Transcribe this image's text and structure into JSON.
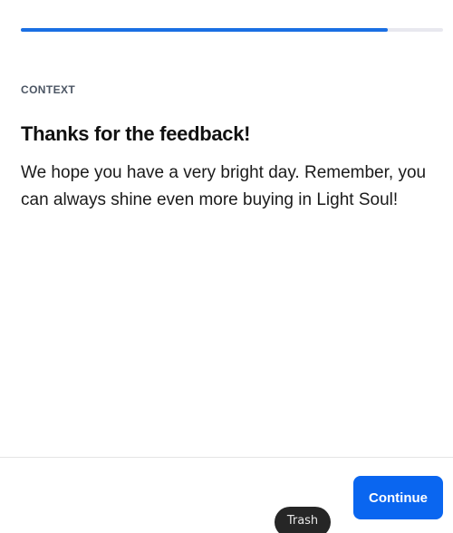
{
  "progress": {
    "fraction": 0.87,
    "fill_color": "#1a6fe3",
    "track_color": "#e8e8ef"
  },
  "section": {
    "label": "CONTEXT"
  },
  "content": {
    "title": "Thanks for the feedback!",
    "body": "We hope you have a very bright day. Remember, you can always shine even more buying in Light Soul!"
  },
  "footer": {
    "continue_label": "Continue",
    "continue_color": "#0a66f0"
  },
  "overlay": {
    "trash_label": "Trash"
  }
}
